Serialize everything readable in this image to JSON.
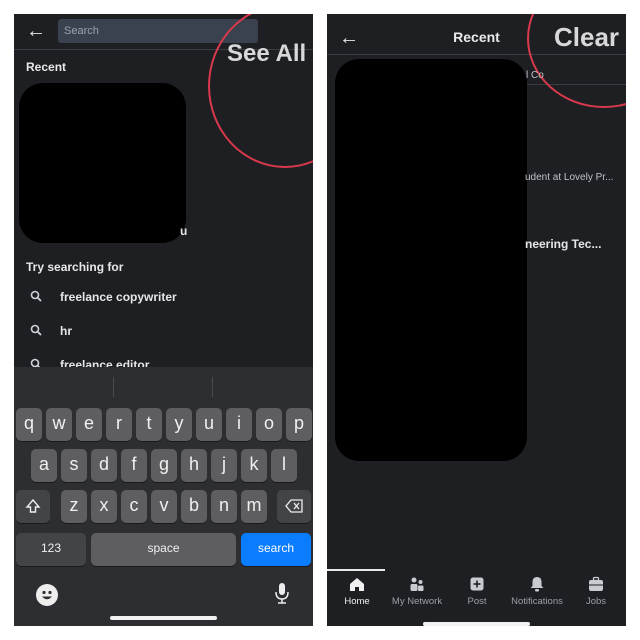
{
  "left": {
    "search": {
      "placeholder": "Search"
    },
    "see_all_label": "See All",
    "recent_heading": "Recent",
    "recent_fragment": "u",
    "try_heading": "Try searching for",
    "suggestions": [
      {
        "icon": "search-icon",
        "label": "freelance copywriter"
      },
      {
        "icon": "search-icon",
        "label": "hr"
      },
      {
        "icon": "search-icon",
        "label": "freelance editor"
      }
    ],
    "keyboard": {
      "row1": [
        "q",
        "w",
        "e",
        "r",
        "t",
        "y",
        "u",
        "i",
        "o",
        "p"
      ],
      "row2": [
        "a",
        "s",
        "d",
        "f",
        "g",
        "h",
        "j",
        "k",
        "l"
      ],
      "row3": [
        "z",
        "x",
        "c",
        "v",
        "b",
        "n",
        "m"
      ],
      "numbers_label": "123",
      "space_label": "space",
      "search_label": "search",
      "shift_icon": "shift-icon",
      "delete_icon": "backspace-icon",
      "emoji_icon": "emoji-icon",
      "mic_icon": "microphone-icon"
    }
  },
  "right": {
    "title": "Recent",
    "clear_label": "Clear",
    "fragments": [
      "l Co",
      "udent at Lovely Pr...",
      "neering Tec..."
    ],
    "tabs": [
      {
        "icon": "home-icon",
        "label": "Home",
        "active": true
      },
      {
        "icon": "my-network-icon",
        "label": "My Network"
      },
      {
        "icon": "post-icon",
        "label": "Post"
      },
      {
        "icon": "notifications-icon",
        "label": "Notifications"
      },
      {
        "icon": "jobs-icon",
        "label": "Jobs"
      }
    ]
  },
  "colors": {
    "highlight_circle": "#d8394b",
    "keyboard_action": "#0a7cff",
    "background": "#1d1f23"
  }
}
